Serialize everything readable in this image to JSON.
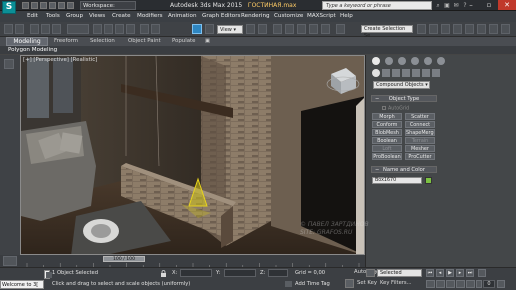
{
  "titlebar": {
    "logo": "S",
    "workspace": "Workspace: Default",
    "app": "Autodesk 3ds Max 2015",
    "file": "ГОСТИНАЯ.max",
    "search_placeholder": "Type a keyword or phrase"
  },
  "menu": [
    "Edit",
    "Tools",
    "Group",
    "Views",
    "Create",
    "Modifiers",
    "Animation",
    "Graph Editors",
    "Rendering",
    "Customize",
    "MAXScript",
    "Help"
  ],
  "toolbar": {
    "view_value": "View",
    "selection_set": "Create Selection Se"
  },
  "ribbon": {
    "tabs": [
      "Modeling",
      "Freeform",
      "Selection",
      "Object Paint",
      "Populate"
    ],
    "sub_label": "Polygon Modeling"
  },
  "viewport": {
    "label": "[+] [Perspective] [Realistic]",
    "watermark_line1": "© ПАВЕЛ ЗАРТДИНОВ",
    "watermark_line2": "SITE: GRAFOS.RU"
  },
  "command_panel": {
    "category": "Compound Objects",
    "object_type_header": "Object Type",
    "autogrid": "AutoGrid",
    "buttons": [
      {
        "label": "Morph",
        "enabled": true
      },
      {
        "label": "Scatter",
        "enabled": true
      },
      {
        "label": "Conform",
        "enabled": true
      },
      {
        "label": "Connect",
        "enabled": true
      },
      {
        "label": "BlobMesh",
        "enabled": true
      },
      {
        "label": "ShapeMerge",
        "enabled": true
      },
      {
        "label": "Boolean",
        "enabled": true
      },
      {
        "label": "Terrain",
        "enabled": false
      },
      {
        "label": "Loft",
        "enabled": false
      },
      {
        "label": "Mesher",
        "enabled": true
      },
      {
        "label": "ProBoolean",
        "enabled": true
      },
      {
        "label": "ProCutter",
        "enabled": true
      }
    ],
    "name_color_header": "Name and Color",
    "object_name": "Box1670",
    "object_color": "#7cc242"
  },
  "timeline": {
    "slider": "100 / 100",
    "ticks": [
      "0",
      "10",
      "20",
      "30",
      "40",
      "50",
      "60",
      "70",
      "80",
      "90",
      "100"
    ]
  },
  "status": {
    "listener": "Welcome to 3[",
    "selected": "1 Object Selected",
    "prompt": "Click and drag to select and scale objects (uniformly)",
    "x_label": "X:",
    "y_label": "Y:",
    "z_label": "Z:",
    "grid": "Grid = 0,00",
    "add_time_tag": "Add Time Tag",
    "auto_key": "Auto Key",
    "set_key": "Set Key",
    "selected_dd": "Selected",
    "key_filters": "Key Filters...",
    "frame": "0"
  }
}
